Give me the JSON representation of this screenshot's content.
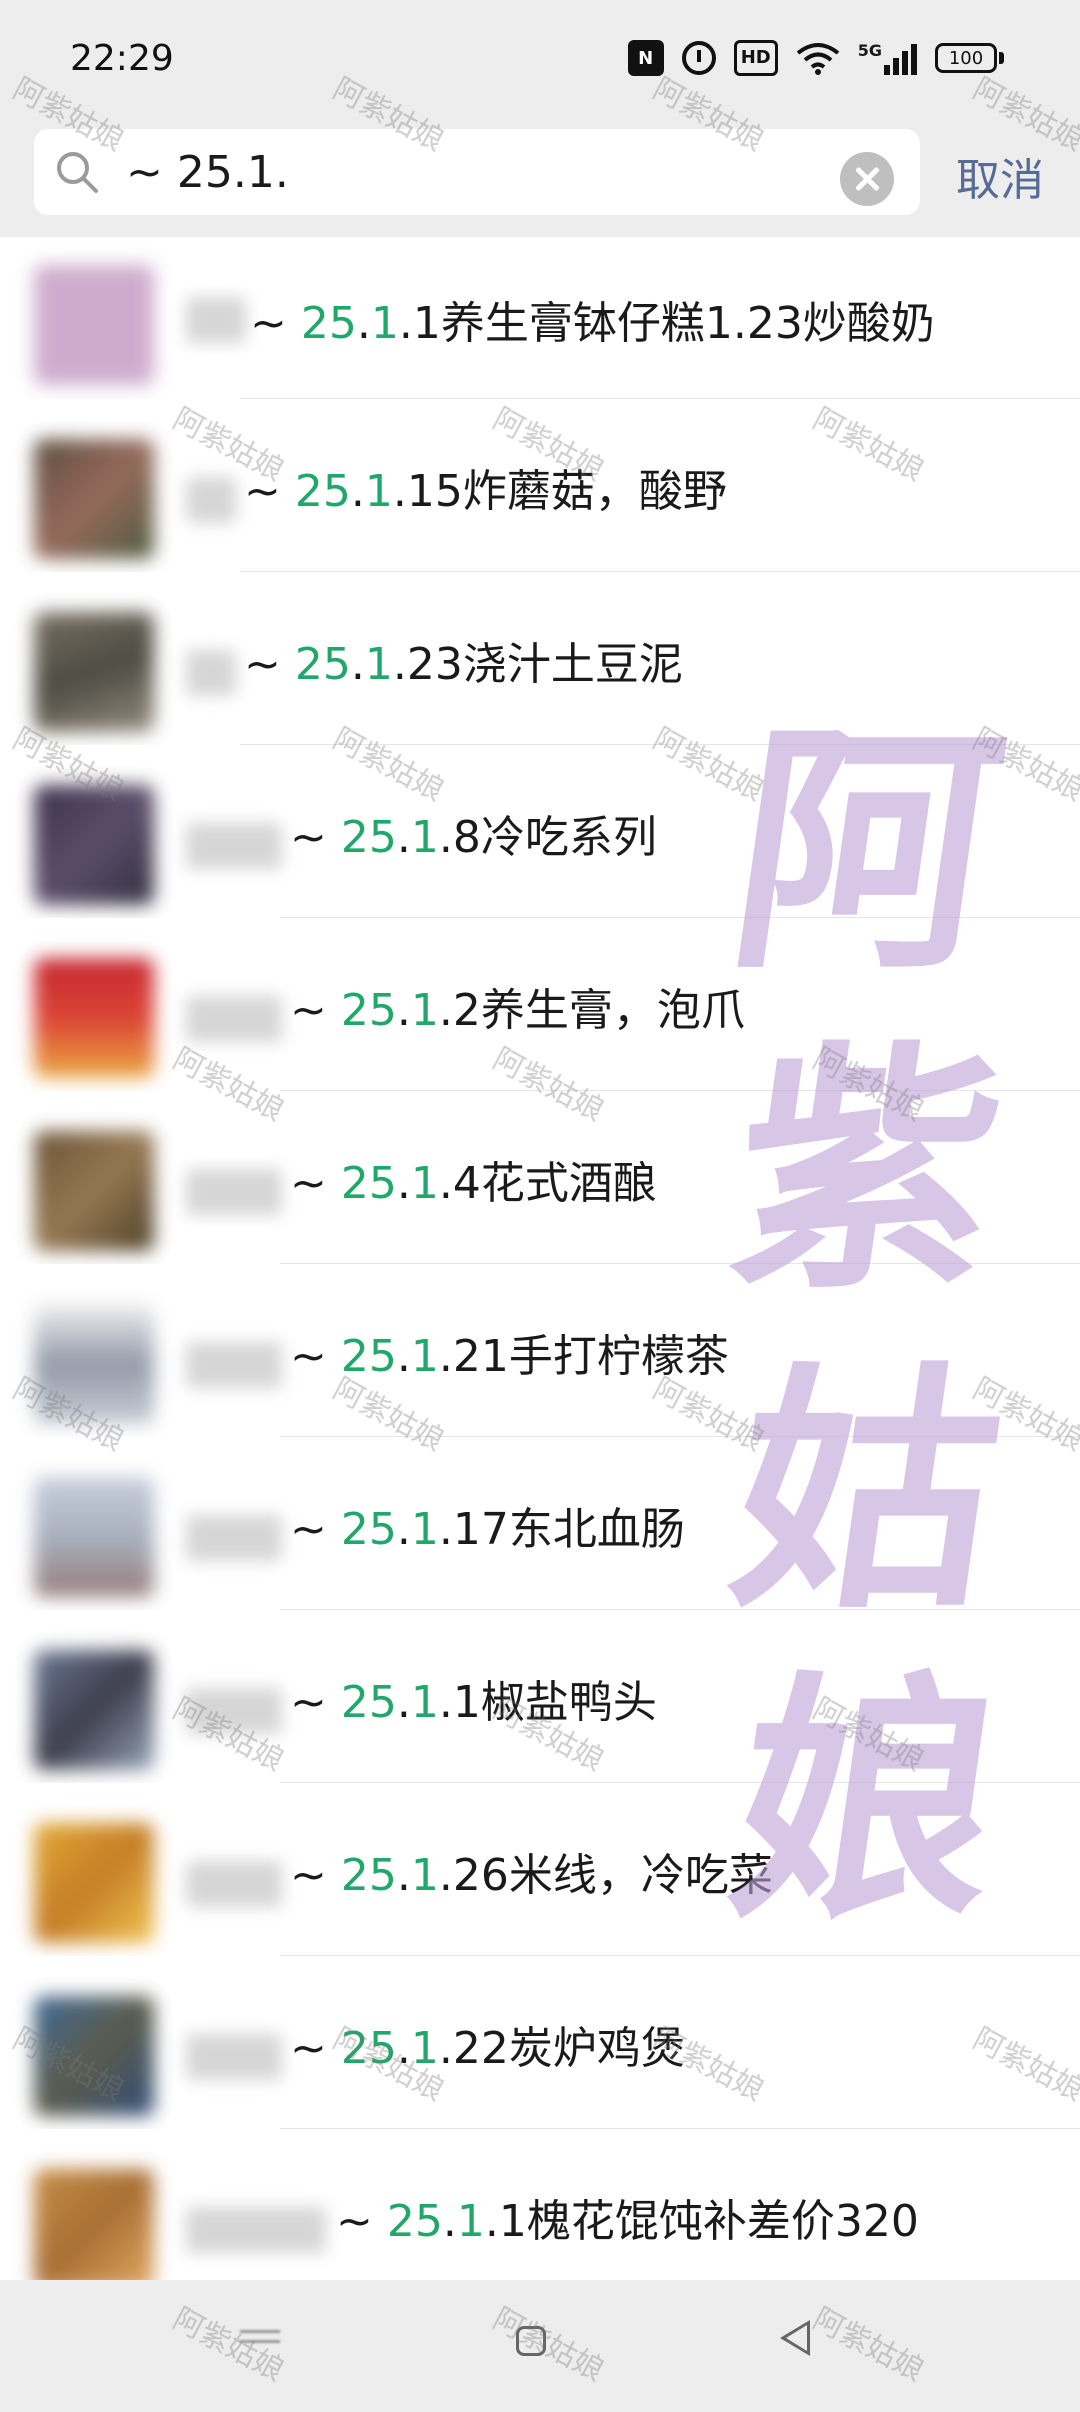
{
  "status_bar": {
    "time": "22:29",
    "nfc_icon": "N",
    "hd_label": "HD",
    "network_label": "5G",
    "battery_level": "100"
  },
  "search": {
    "query": "~ 25.1.",
    "cancel_label": "取消"
  },
  "results": [
    {
      "prefix": "~ ",
      "hl1": "25",
      "mid": ".",
      "hl2": "1",
      "rest": ".1养生膏钵仔糕1.23炒酸奶"
    },
    {
      "prefix": "~ ",
      "hl1": "25",
      "mid": ".",
      "hl2": "1",
      "rest": ".15炸蘑菇，酸野"
    },
    {
      "prefix": "~ ",
      "hl1": "25",
      "mid": ".",
      "hl2": "1",
      "rest": ".23浇汁土豆泥"
    },
    {
      "prefix": "~ ",
      "hl1": "25",
      "mid": ".",
      "hl2": "1",
      "rest": ".8冷吃系列"
    },
    {
      "prefix": "~ ",
      "hl1": "25",
      "mid": ".",
      "hl2": "1",
      "rest": ".2养生膏，泡爪"
    },
    {
      "prefix": "~ ",
      "hl1": "25",
      "mid": ".",
      "hl2": "1",
      "rest": ".4花式酒酿"
    },
    {
      "prefix": "~ ",
      "hl1": "25",
      "mid": ".",
      "hl2": "1",
      "rest": ".21手打柠檬茶"
    },
    {
      "prefix": "~ ",
      "hl1": "25",
      "mid": ".",
      "hl2": "1",
      "rest": ".17东北血肠"
    },
    {
      "prefix": "~ ",
      "hl1": "25",
      "mid": ".",
      "hl2": "1",
      "rest": ".1椒盐鸭头"
    },
    {
      "prefix": "~ ",
      "hl1": "25",
      "mid": ".",
      "hl2": "1",
      "rest": ".26米线，冷吃菜"
    },
    {
      "prefix": "~ ",
      "hl1": "25",
      "mid": ".",
      "hl2": "1",
      "rest": ".22炭炉鸡煲"
    },
    {
      "prefix": "~ ",
      "hl1": "25",
      "mid": ".",
      "hl2": "1",
      "rest": ".1槐花馄饨补差价320"
    }
  ],
  "watermark": {
    "small_text": "阿紫姑娘",
    "large_chars": [
      "阿",
      "紫",
      "姑",
      "娘"
    ]
  },
  "colors": {
    "highlight": "#20a86a",
    "cancel": "#576b95",
    "header_bg": "#ededed"
  },
  "icons": {
    "search": "search-icon",
    "clear": "clear-icon",
    "nav_home": "square-icon",
    "nav_back": "triangle-back-icon",
    "nav_menu": "menu-icon"
  }
}
